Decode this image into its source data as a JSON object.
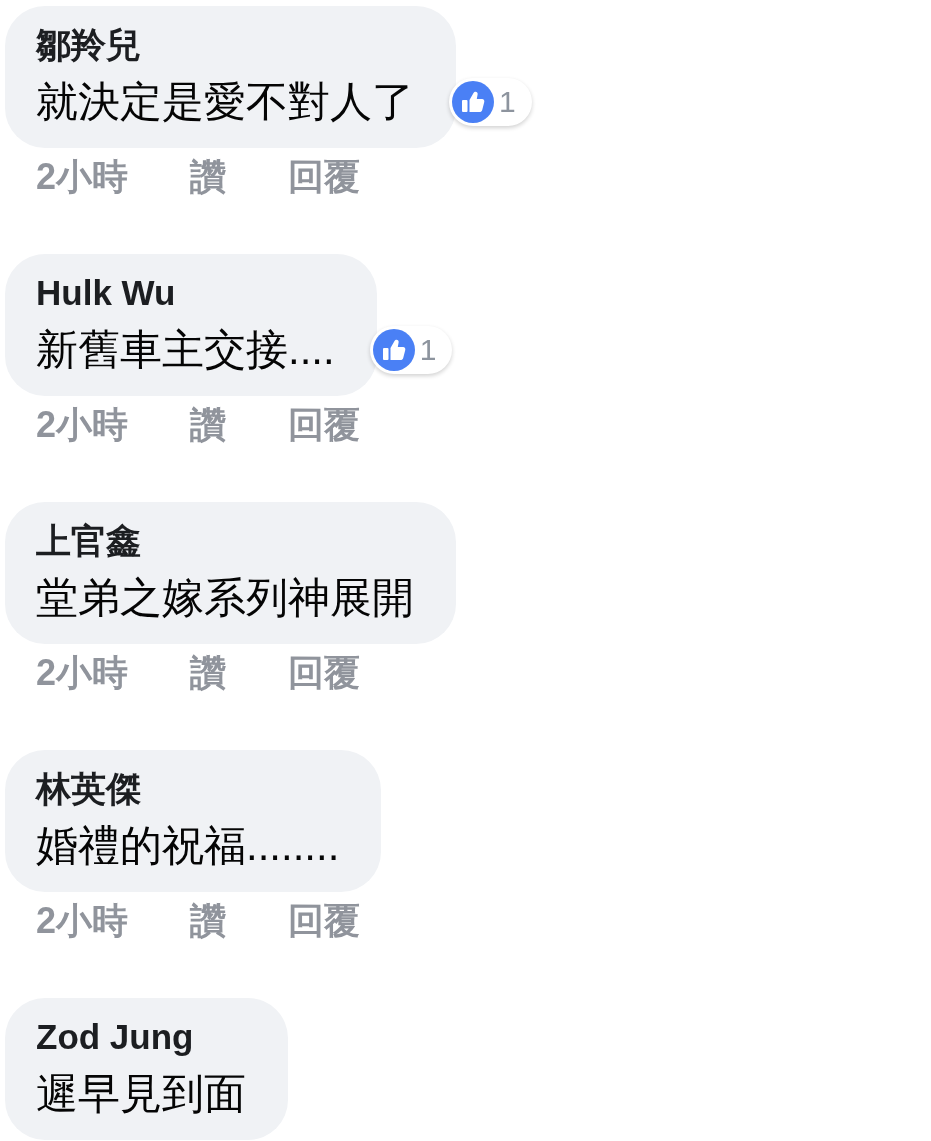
{
  "comments": [
    {
      "author": "鄒羚兒",
      "text": "就決定是愛不對人了",
      "reactions": {
        "count": "1"
      },
      "actions": {
        "time": "2小時",
        "like": "讚",
        "reply": "回覆"
      }
    },
    {
      "author": "Hulk Wu",
      "text": "新舊車主交接....",
      "reactions": {
        "count": "1"
      },
      "actions": {
        "time": "2小時",
        "like": "讚",
        "reply": "回覆"
      }
    },
    {
      "author": "上官鑫",
      "text": "堂弟之嫁系列神展開",
      "actions": {
        "time": "2小時",
        "like": "讚",
        "reply": "回覆"
      }
    },
    {
      "author": "林英傑",
      "text": "婚禮的祝福........",
      "actions": {
        "time": "2小時",
        "like": "讚",
        "reply": "回覆"
      }
    },
    {
      "author": "Zod Jung",
      "text": "遲早見到面"
    }
  ]
}
